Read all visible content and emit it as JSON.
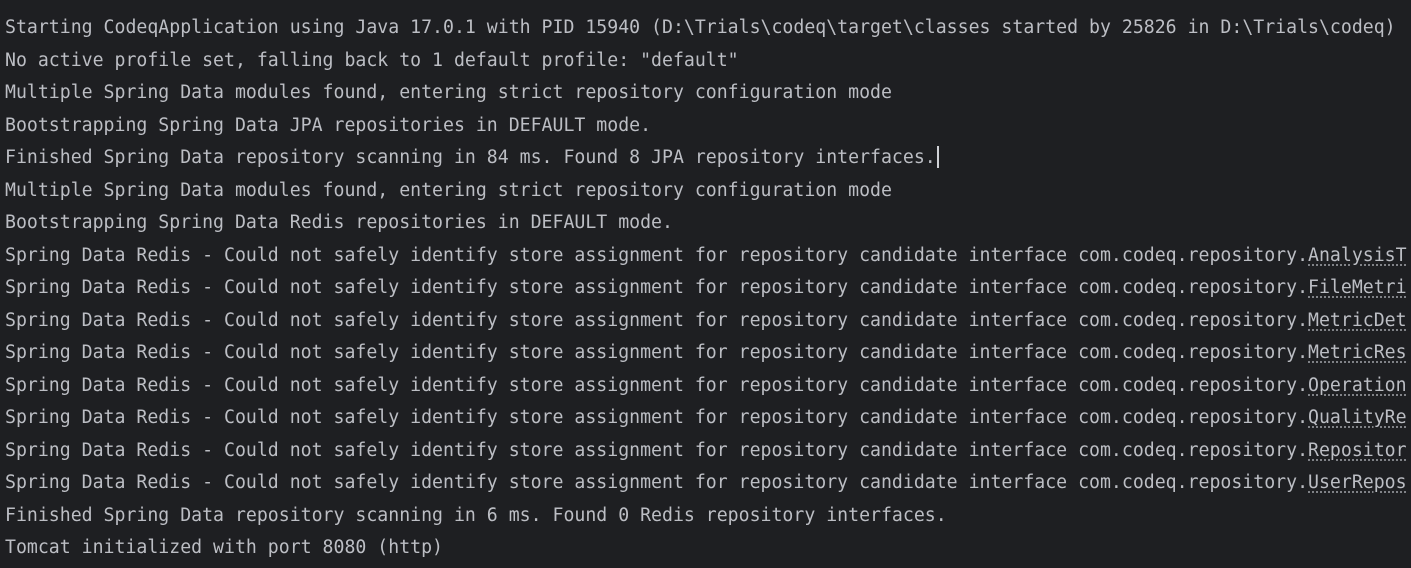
{
  "console": {
    "lines": [
      "Starting CodeqApplication using Java 17.0.1 with PID 15940 (D:\\Trials\\codeq\\target\\classes started by 25826 in D:\\Trials\\codeq)",
      "No active profile set, falling back to 1 default profile: \"default\"",
      "Multiple Spring Data modules found, entering strict repository configuration mode",
      "Bootstrapping Spring Data JPA repositories in DEFAULT mode.",
      "Finished Spring Data repository scanning in 84 ms. Found 8 JPA repository interfaces.",
      "Multiple Spring Data modules found, entering strict repository configuration mode",
      "Bootstrapping Spring Data Redis repositories in DEFAULT mode."
    ],
    "redis_prefix": "Spring Data Redis - Could not safely identify store assignment for repository candidate interface com.codeq.repository.",
    "redis_links": [
      "AnalysisT",
      "FileMetri",
      "MetricDet",
      "MetricRes",
      "Operation",
      "QualityRe",
      "Repositor",
      "UserRepos"
    ],
    "tail_lines": [
      "Finished Spring Data repository scanning in 6 ms. Found 0 Redis repository interfaces.",
      "Tomcat initialized with port 8080 (http)"
    ]
  }
}
